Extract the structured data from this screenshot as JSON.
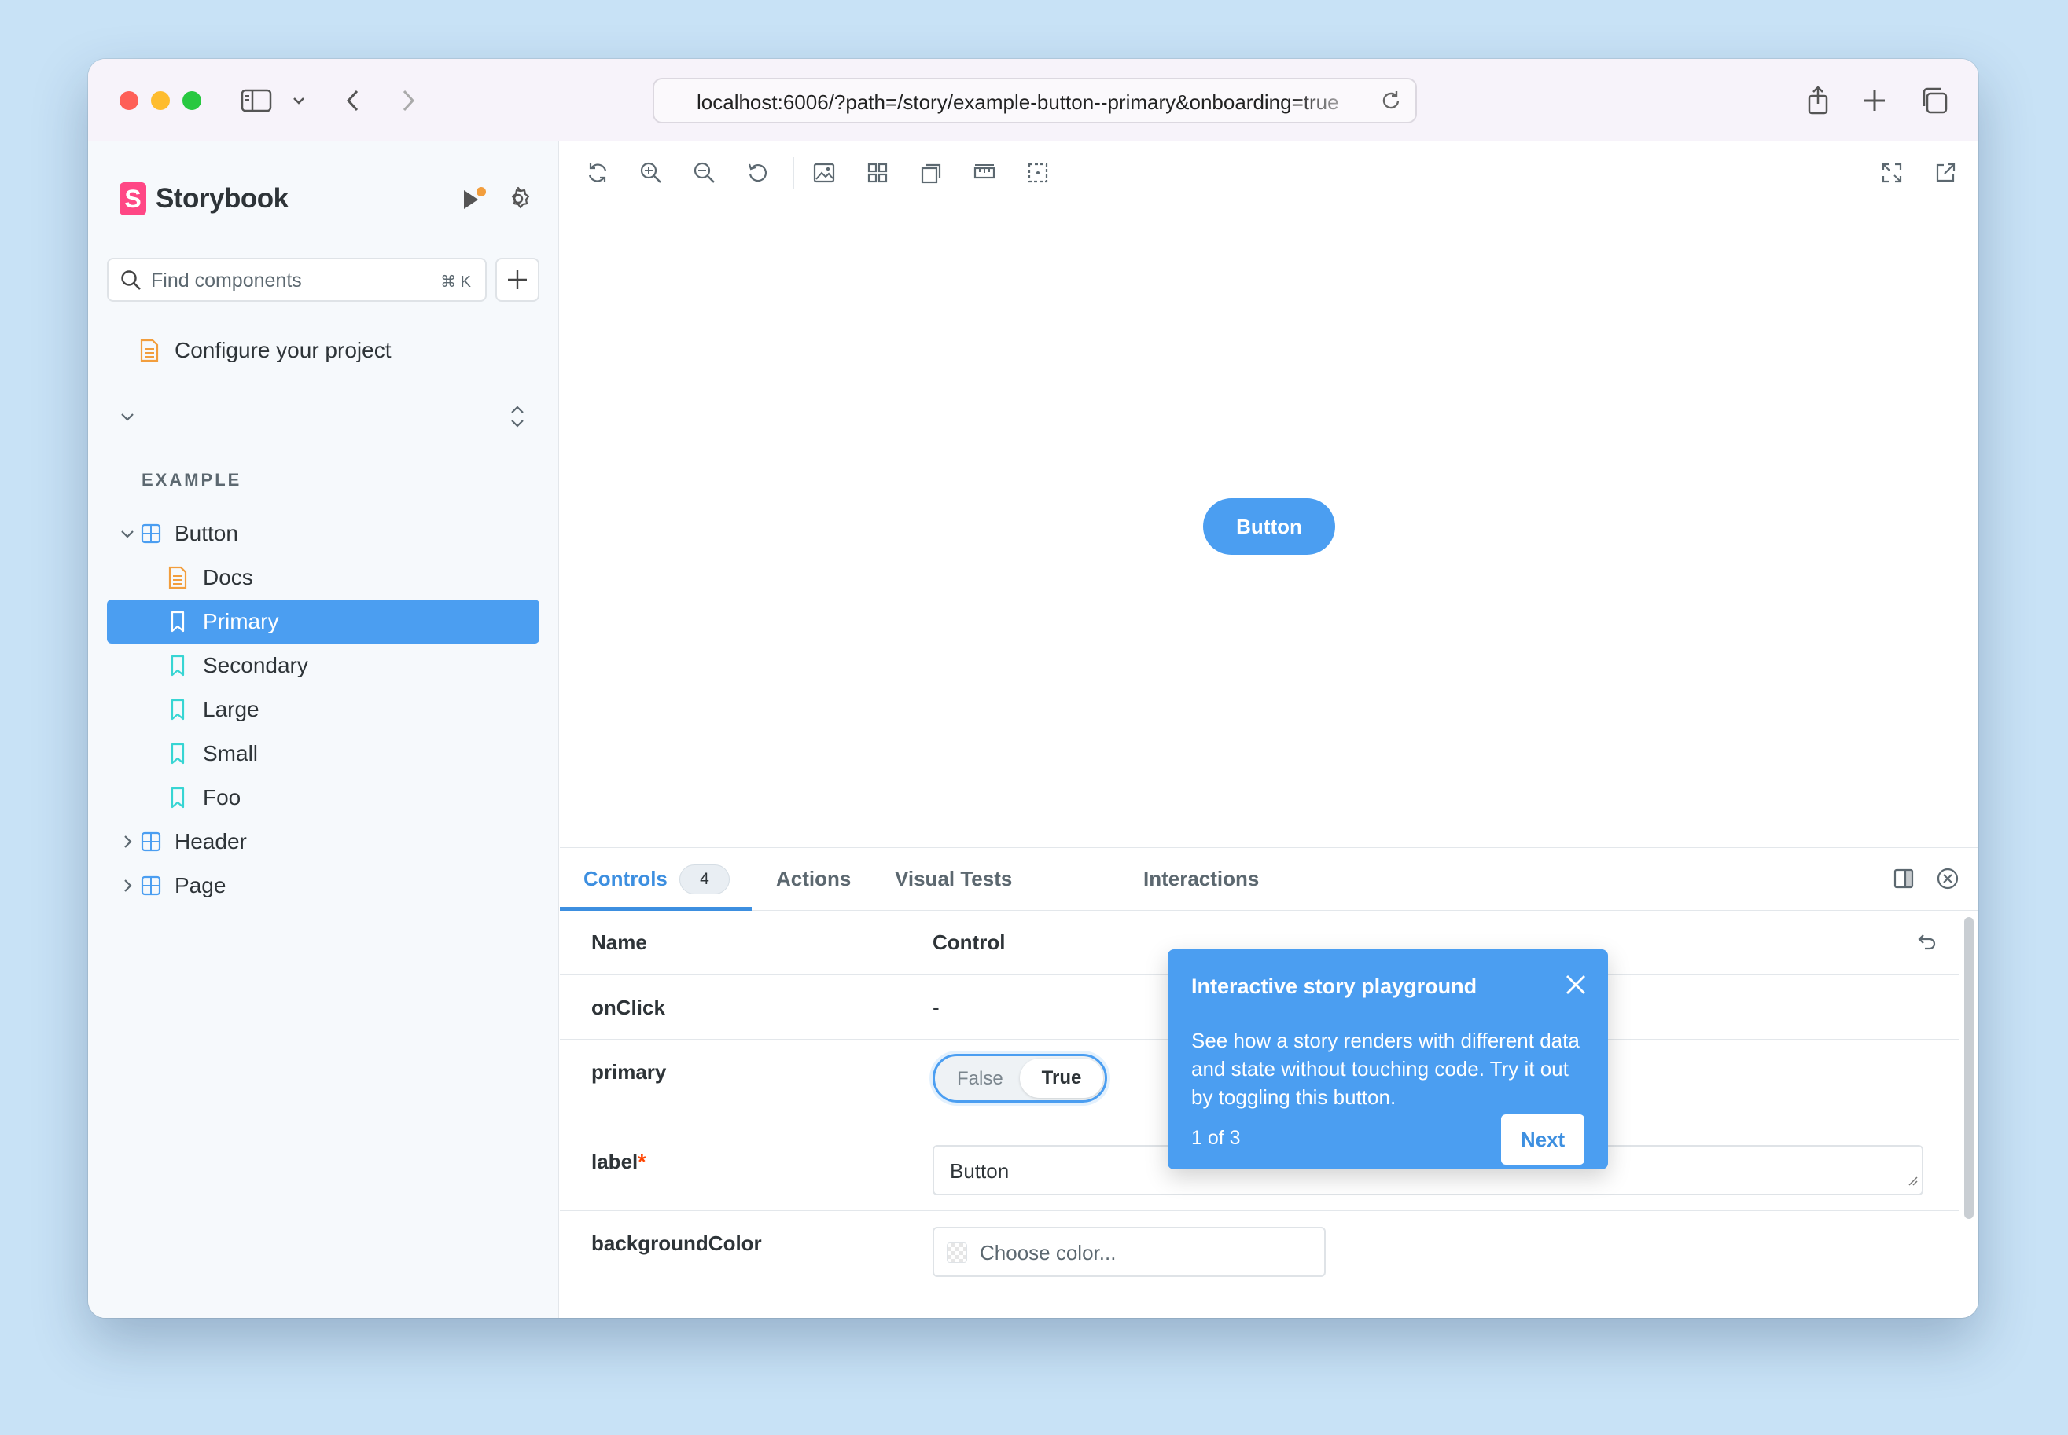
{
  "browser": {
    "url": "localhost:6006/?path=/story/example-button--primary&onboarding=true"
  },
  "sidebar": {
    "brand": "Storybook",
    "search_placeholder": "Find components",
    "search_shortcut": "⌘ K",
    "configure_label": "Configure your project",
    "group_label": "EXAMPLE",
    "items": [
      {
        "label": "Button",
        "type": "component",
        "expanded": true
      },
      {
        "label": "Docs",
        "type": "docs"
      },
      {
        "label": "Primary",
        "type": "story",
        "selected": true
      },
      {
        "label": "Secondary",
        "type": "story"
      },
      {
        "label": "Large",
        "type": "story"
      },
      {
        "label": "Small",
        "type": "story"
      },
      {
        "label": "Foo",
        "type": "story"
      },
      {
        "label": "Header",
        "type": "component",
        "expanded": false
      },
      {
        "label": "Page",
        "type": "component",
        "expanded": false
      }
    ]
  },
  "canvas": {
    "button_label": "Button"
  },
  "panel": {
    "tabs": [
      {
        "label": "Controls",
        "badge": "4",
        "active": true
      },
      {
        "label": "Actions"
      },
      {
        "label": "Visual Tests"
      },
      {
        "label": "Interactions"
      }
    ],
    "columns": {
      "name": "Name",
      "control": "Control"
    },
    "rows": {
      "onclick": {
        "name": "onClick",
        "value": "-"
      },
      "primary": {
        "name": "primary",
        "false_label": "False",
        "true_label": "True"
      },
      "label": {
        "name": "label",
        "required_mark": "*",
        "value": "Button"
      },
      "background": {
        "name": "backgroundColor",
        "placeholder": "Choose color..."
      }
    }
  },
  "onboarding": {
    "title": "Interactive story playground",
    "body": "See how a story renders with different data and state without touching code. Try it out by toggling this button.",
    "step": "1 of 3",
    "next_label": "Next"
  },
  "colors": {
    "accent": "#4b9ef1",
    "brand": "#ff4785",
    "docs_icon": "#f29e3d",
    "story_icon": "#37d5d3",
    "component_icon": "#4b9ef1"
  }
}
